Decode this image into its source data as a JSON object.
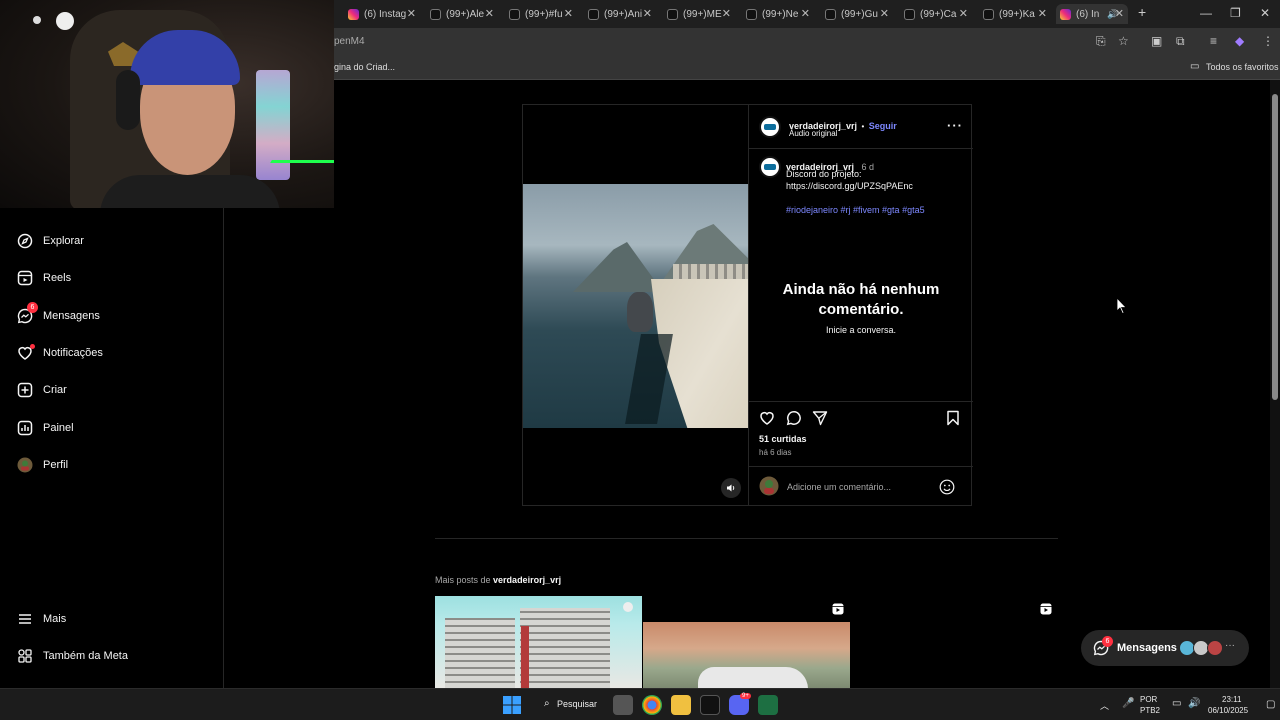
{
  "browser": {
    "tabs": [
      {
        "title": "(6) Instag",
        "icon": "instagram-icon"
      },
      {
        "title": "(99+)Ale",
        "icon": "tiktok-icon"
      },
      {
        "title": "(99+)#fu",
        "icon": "tiktok-icon"
      },
      {
        "title": "(99+)Ani",
        "icon": "tiktok-icon"
      },
      {
        "title": "(99+)ME",
        "icon": "tiktok-icon"
      },
      {
        "title": "(99+)Ne",
        "icon": "tiktok-icon"
      },
      {
        "title": "(99+)Gu",
        "icon": "tiktok-icon"
      },
      {
        "title": "(99+)Ca",
        "icon": "tiktok-icon"
      },
      {
        "title": "(99+)Ka",
        "icon": "tiktok-icon"
      },
      {
        "title": "(6) In",
        "icon": "instagram-icon"
      }
    ],
    "address_fragment": "penM4",
    "bookmark_fragment": "gina do Criad...",
    "all_favorites": "Todos os favoritos"
  },
  "sidebar": {
    "items": [
      {
        "label": "Explorar",
        "icon": "compass-icon"
      },
      {
        "label": "Reels",
        "icon": "reels-icon"
      },
      {
        "label": "Mensagens",
        "icon": "messenger-icon",
        "badge": "6"
      },
      {
        "label": "Notificações",
        "icon": "heart-icon"
      },
      {
        "label": "Criar",
        "icon": "plus-square-icon"
      },
      {
        "label": "Painel",
        "icon": "chart-icon"
      },
      {
        "label": "Perfil",
        "icon": "avatar-icon"
      }
    ],
    "bottom": [
      {
        "label": "Mais",
        "icon": "menu-icon"
      },
      {
        "label": "Também da Meta",
        "icon": "meta-icon"
      }
    ]
  },
  "post": {
    "username": "verdadeirorj_vrj",
    "separator": "•",
    "follow": "Seguir",
    "audio": "Áudio original",
    "caption_user": "verdadeirorj_vrj",
    "caption_time": "6 d",
    "caption_line1": "Discord do projeto:",
    "caption_line2": "https://discord.gg/UPZSqPAEnc",
    "hashtags": "#riodejaneiro #rj #fivem #gta #gta5",
    "empty_title_1": "Ainda não há nenhum",
    "empty_title_2": "comentário.",
    "empty_sub": "Inicie a conversa.",
    "likes": "51 curtidas",
    "ago": "há 6 dias",
    "comment_placeholder": "Adicione um comentário..."
  },
  "more": {
    "prefix": "Mais posts de",
    "user": "verdadeirorj_vrj"
  },
  "messages_pill": {
    "label": "Mensagens",
    "badge": "6"
  },
  "taskbar": {
    "search": "Pesquisar",
    "lang1": "POR",
    "lang2": "PTB2",
    "time": "23:11",
    "date": "06/10/2025",
    "discord_badge": "9+"
  },
  "colors": {
    "accent": "#7d88ff",
    "badge": "#ff3040",
    "background": "#000000"
  }
}
